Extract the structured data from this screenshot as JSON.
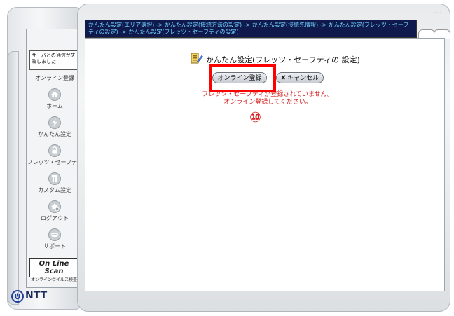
{
  "sidebar": {
    "notice": "サーバとの通信が失敗しました",
    "online_reg_label": "オンライン登録",
    "items": [
      {
        "label": "ホーム",
        "icon": "home-icon"
      },
      {
        "label": "かんたん設定",
        "icon": "lightning-icon"
      },
      {
        "label": "フレッツ・セーフティ",
        "icon": "lock-icon"
      },
      {
        "label": "カスタム設定",
        "icon": "custom-tools-icon"
      },
      {
        "label": "ログアウト",
        "icon": "logout-icon"
      },
      {
        "label": "サポート",
        "icon": "support-icon"
      }
    ],
    "scan": {
      "title": "On Line Scan",
      "subtitle": "オンラインウイルス検査"
    },
    "logo_text": "NTT"
  },
  "main": {
    "breadcrumb": "かんたん設定(エリア選択) -> かんたん設定(接続方法の設定) -> かんたん設定(接続先情報) -> かんたん設定(フレッツ・セーフティの設定) -> かんたん設定(フレッツ・セーフティの設定)",
    "page_title": "かんたん設定(フレッツ・セーフティの 設定)",
    "online_button": "オンライン登録",
    "cancel_button": "キャンセル",
    "message_line1": "フレッツ・セーフティが登録されていません。",
    "message_line2": "オンライン登録してください。",
    "step_marker": "⑩"
  },
  "colors": {
    "title_bar": "#10194c",
    "breadcrumb_text": "#6fd1ff",
    "message_text": "#d42020",
    "highlight": "#ff0000"
  }
}
